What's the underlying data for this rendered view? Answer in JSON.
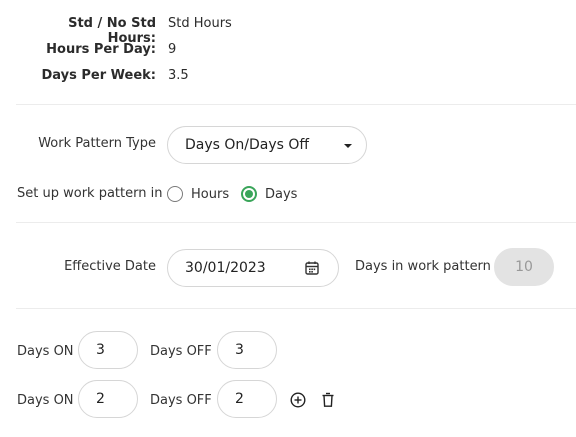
{
  "summary": {
    "std_label": "Std / No Std Hours:",
    "std_value": "Std Hours",
    "hours_label": "Hours Per Day:",
    "hours_value": "9",
    "days_label": "Days Per Week:",
    "days_value": "3.5"
  },
  "pattern": {
    "type_label": "Work Pattern Type",
    "type_value": "Days On/Days Off",
    "setup_label": "Set up work pattern in",
    "option_hours": "Hours",
    "option_days": "Days",
    "selected": "Days"
  },
  "effective": {
    "date_label": "Effective Date",
    "date_value": "30/01/2023",
    "days_in_pattern_label": "Days in work pattern",
    "days_in_pattern_value": "10"
  },
  "rows": [
    {
      "on_label": "Days ON",
      "on_value": "3",
      "off_label": "Days OFF",
      "off_value": "3"
    },
    {
      "on_label": "Days ON",
      "on_value": "2",
      "off_label": "Days OFF",
      "off_value": "2"
    }
  ],
  "colors": {
    "accent": "#3aa55a",
    "border": "#d6d6d6",
    "disabled_bg": "#e3e3e3"
  },
  "icons": {
    "dropdown": "caret-down-icon",
    "calendar": "calendar-icon",
    "add": "plus-circle-icon",
    "delete": "trash-icon"
  }
}
